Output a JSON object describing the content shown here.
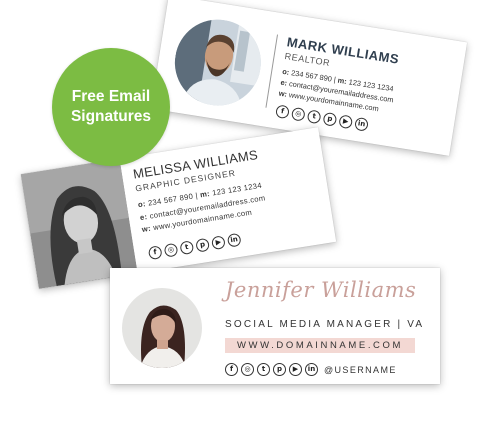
{
  "badge": {
    "line1": "Free Email",
    "line2": "Signatures",
    "color": "#7cbc43"
  },
  "cards": [
    {
      "name": "MARK WILLIAMS",
      "title": "REALTOR",
      "office_label": "o:",
      "office": "234 567 890",
      "mobile_label": "m:",
      "mobile": "123 123 1234",
      "email_label": "e:",
      "email": "contact@youremailaddress.com",
      "web_label": "w:",
      "web": "www.yourdomainname.com",
      "socials": [
        "facebook-icon",
        "instagram-icon",
        "twitter-icon",
        "pinterest-icon",
        "youtube-icon",
        "linkedin-icon"
      ]
    },
    {
      "name": "MELISSA WILLIAMS",
      "title": "GRAPHIC DESIGNER",
      "office_label": "o:",
      "office": "234 567 890",
      "mobile_label": "m:",
      "mobile": "123 123 1234",
      "email_label": "e:",
      "email": "contact@youremailaddress.com",
      "web_label": "w:",
      "web": "www.yourdomainname.com",
      "socials": [
        "facebook-icon",
        "instagram-icon",
        "twitter-icon",
        "pinterest-icon",
        "youtube-icon",
        "linkedin-icon"
      ]
    },
    {
      "name": "Jennifer Williams",
      "title": "SOCIAL MEDIA MANAGER  |  VA",
      "web": "WWW.DOMAINNAME.COM",
      "username": "@USERNAME",
      "accent": "#f3d8d3",
      "socials": [
        "facebook-icon",
        "instagram-icon",
        "twitter-icon",
        "pinterest-icon",
        "youtube-icon",
        "linkedin-icon"
      ]
    }
  ]
}
